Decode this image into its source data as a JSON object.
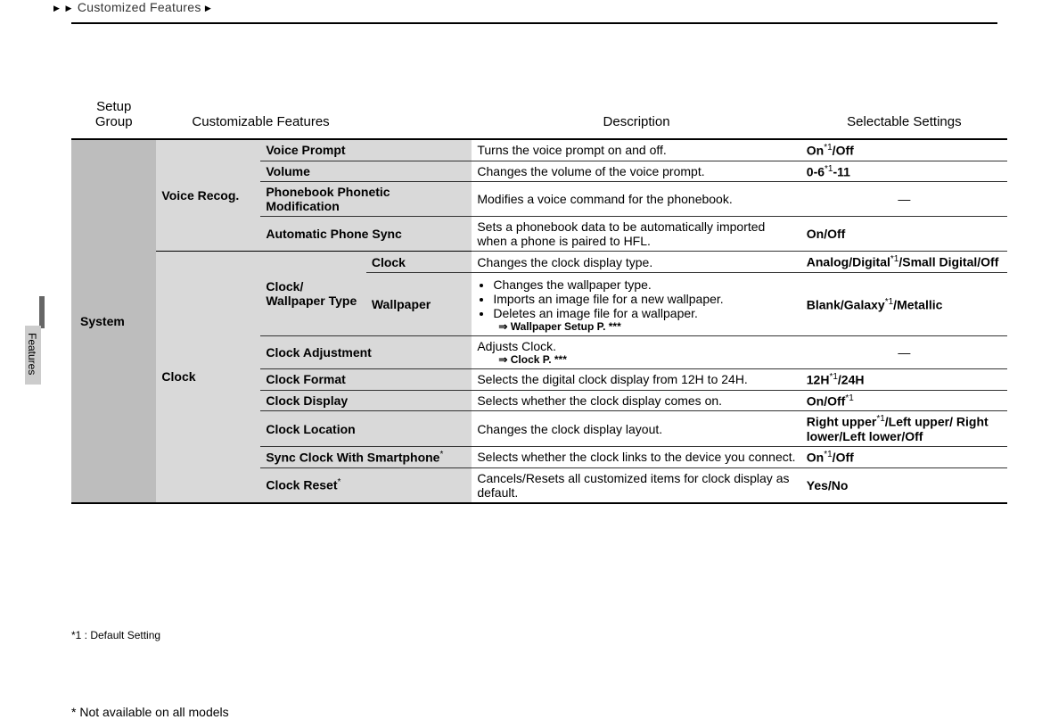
{
  "breadcrumb": {
    "marker": "▶",
    "title": "Customized Features",
    "trailing_marker": "▶"
  },
  "side_tab": "Features",
  "headers": {
    "group": "Setup\nGroup",
    "features": "Customizable Features",
    "description": "Description",
    "settings": "Selectable Settings"
  },
  "group": "System",
  "subgroups": {
    "voice": "Voice Recog.",
    "clock": "Clock",
    "clock_wp": "Clock/ Wallpaper Type"
  },
  "rows": {
    "voice_prompt": {
      "feat": "Voice Prompt",
      "desc": "Turns the voice prompt on and off.",
      "sett": "On*1/Off"
    },
    "volume": {
      "feat": "Volume",
      "desc": "Changes the volume of the voice prompt.",
      "sett": "0-6*1-11"
    },
    "pb_phonetic": {
      "feat": "Phonebook Phonetic Modification",
      "desc": "Modifies a voice command for the phonebook.",
      "sett": "—"
    },
    "auto_sync": {
      "feat": "Automatic Phone Sync",
      "desc": "Sets a phonebook data to be automatically imported when a phone is paired to HFL.",
      "sett": "On/Off"
    },
    "clock_type": {
      "feat": "Clock",
      "desc": "Changes the clock display type.",
      "sett": "Analog/Digital*1/Small Digital/Off"
    },
    "wallpaper": {
      "feat": "Wallpaper",
      "desc_b1": "Changes the wallpaper type.",
      "desc_b2": "Imports an image file for a new wallpaper.",
      "desc_b3": "Deletes an image file for a wallpaper.",
      "ref": "⇒   Wallpaper Setup P. ***",
      "sett": "Blank/Galaxy*1/Metallic"
    },
    "clock_adj": {
      "feat": "Clock Adjustment",
      "desc": "Adjusts Clock.",
      "ref": "⇒   Clock P. ***",
      "sett": "—"
    },
    "clock_format": {
      "feat": "Clock Format",
      "desc": "Selects the digital clock display from 12H to 24H.",
      "sett": "12H*1/24H"
    },
    "clock_display": {
      "feat": "Clock Display",
      "desc": "Selects whether the clock display comes on.",
      "sett": "On/Off*1"
    },
    "clock_location": {
      "feat": "Clock Location",
      "desc": "Changes the clock display layout.",
      "sett": "Right upper*1/Left upper/ Right lower/Left lower/Off"
    },
    "sync_smartphone": {
      "feat": "Sync Clock With Smartphone*",
      "desc": "Selects whether the clock links to the device you connect.",
      "sett": "On*1/Off"
    },
    "clock_reset": {
      "feat": "Clock Reset*",
      "desc": "Cancels/Resets all customized items for clock display as default.",
      "sett": "Yes/No"
    }
  },
  "footnotes": {
    "f1": "*1 : Default Setting",
    "f2": "*   Not available on all models"
  }
}
